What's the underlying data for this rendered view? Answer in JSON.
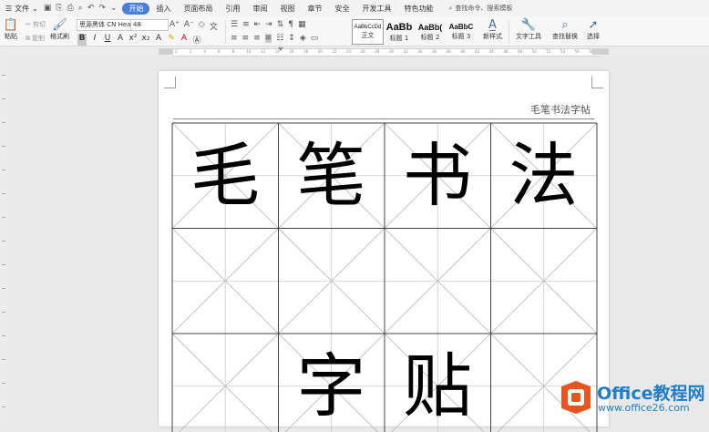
{
  "menubar": {
    "file_label": "文件",
    "tabs": [
      "开始",
      "插入",
      "页面布局",
      "引用",
      "审阅",
      "视图",
      "章节",
      "安全",
      "开发工具",
      "特色功能"
    ],
    "active_tab": "开始",
    "search_label": "查找命令、搜索模板"
  },
  "ribbon": {
    "paste_label": "粘贴",
    "cut_label": "剪切",
    "copy_label": "复制",
    "format_painter_label": "格式刷",
    "font_name": "思源黑体 CN Hea",
    "font_size": "48",
    "styles": [
      {
        "sample": "AaBbCcDd",
        "label": "正文"
      },
      {
        "sample": "AaBb",
        "label": "标题 1"
      },
      {
        "sample": "AaBb(",
        "label": "标题 2"
      },
      {
        "sample": "AaBbC",
        "label": "标题 3"
      }
    ],
    "new_style_label": "新样式",
    "text_tools_label": "文字工具",
    "find_replace_label": "查找替换",
    "select_label": "选择"
  },
  "ruler": {
    "ticks": [
      "2",
      "2",
      "4",
      "6",
      "8",
      "10",
      "12",
      "14",
      "16",
      "18",
      "20",
      "22",
      "24",
      "26",
      "28",
      "30",
      "32",
      "34",
      "36",
      "38",
      "40",
      "42",
      "44",
      "46",
      "48",
      "50",
      "52",
      "54",
      "56",
      "58"
    ]
  },
  "document": {
    "header_text": "毛笔书法字帖",
    "grid": {
      "rows": [
        [
          "毛",
          "笔",
          "书",
          "法"
        ],
        [
          "",
          "",
          "",
          ""
        ],
        [
          "",
          "字",
          "贴",
          ""
        ]
      ]
    }
  },
  "watermark": {
    "title": "Office教程网",
    "url": "www.office26.com",
    "brand_color": "#e8541e",
    "text_color": "#1f7ec7"
  }
}
